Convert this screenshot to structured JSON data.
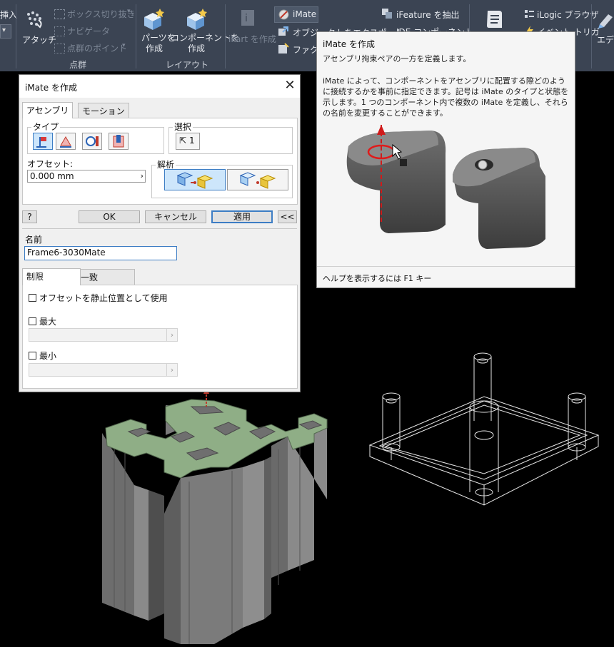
{
  "ribbon": {
    "insert_label": "挿入",
    "attach_label": "アタッチ",
    "box_trim_label": "ボックス切り抜き",
    "navigator_label": "ナビゲータ",
    "point_cloud_point_label": "点群のポイント",
    "point_cloud_group": "点群",
    "create_part_label": "パーツを\n作成",
    "create_component_label": "コンポーネントを\n作成",
    "layout_group": "レイアウト",
    "create_ipart_label": "iPart を作成",
    "imate_label": "iMate",
    "export_object_label": "オブジェクトをエクスポート",
    "factory_label": "ファクト",
    "extract_ifeature_label": "iFeature を抽出",
    "ide_component_label": "IDE コンポーネント",
    "ilogic_browser_label": "iLogic ブラウザ",
    "event_trigger_label": "イベント トリガ",
    "editor_label": "エディ"
  },
  "tooltip": {
    "title": "iMate を作成",
    "subtitle": "アセンブリ拘束ペアの一方を定義します。",
    "body": "iMate によって、コンポーネントをアセンブリに配置する際どのように接続するかを事前に指定できます。記号は iMate のタイプと状態を示します。1 つのコンポーネント内で複数の iMate を定義し、それらの名前を変更することができます。",
    "footer": "ヘルプを表示するには F1 キー"
  },
  "dialog": {
    "title": "iMate を作成",
    "tabs": [
      "アセンブリ",
      "モーション"
    ],
    "type_legend": "タイプ",
    "select_legend": "選択",
    "select_button": "1",
    "offset_label": "オフセット:",
    "offset_value": "0.000 mm",
    "solution_legend": "解析",
    "ok_label": "OK",
    "cancel_label": "キャンセル",
    "apply_label": "適用",
    "collapse_label": "<<",
    "help_label": "?",
    "name_label": "名前",
    "name_value": "Frame6-3030Mate",
    "lower_tabs": [
      "制限",
      "一致"
    ],
    "use_offset_rest": "オフセットを静止位置として使用",
    "max_label": "最大",
    "min_label": "最小"
  },
  "colors": {
    "ribbon_bg": "#3b4453",
    "accent": "#3d7dc4",
    "profile_face": "#8fae86",
    "viewport_bg": "#000000"
  }
}
